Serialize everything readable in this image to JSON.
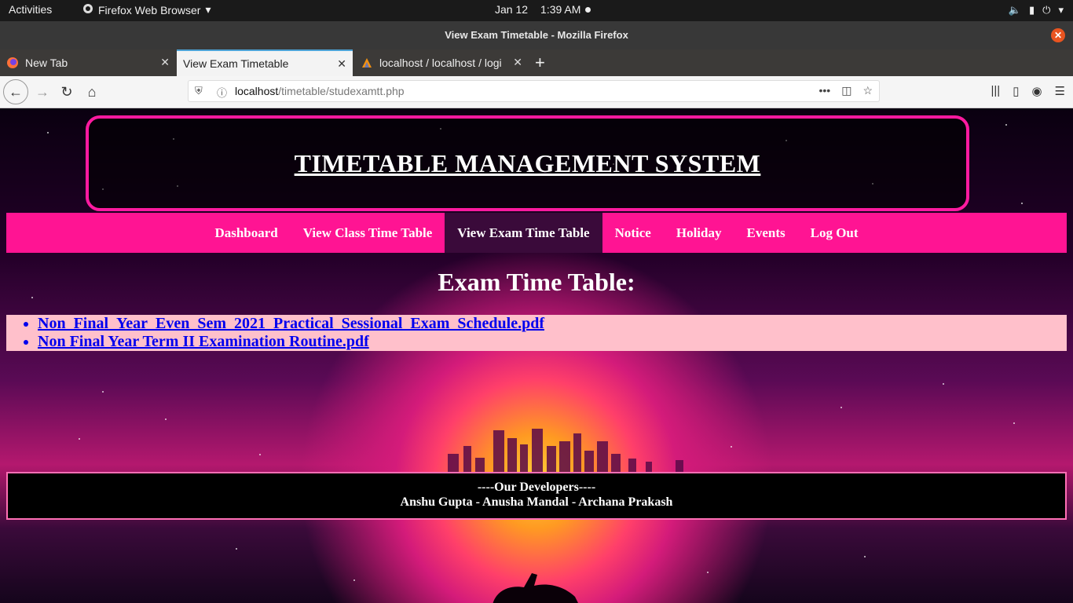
{
  "system": {
    "activities": "Activities",
    "app_name": "Firefox Web Browser",
    "date": "Jan 12",
    "time": "1:39 AM"
  },
  "window": {
    "title": "View Exam Timetable - Mozilla Firefox"
  },
  "tabs": [
    {
      "label": "New Tab"
    },
    {
      "label": "View Exam Timetable"
    },
    {
      "label": "localhost / localhost / logi"
    }
  ],
  "address": {
    "host": "localhost",
    "path": "/timetable/studexamtt.php"
  },
  "page": {
    "header_title": "TIMETABLE MANAGEMENT SYSTEM",
    "menu": [
      {
        "label": "Dashboard"
      },
      {
        "label": "View Class Time Table"
      },
      {
        "label": "View Exam Time Table"
      },
      {
        "label": "Notice"
      },
      {
        "label": "Holiday"
      },
      {
        "label": "Events"
      },
      {
        "label": "Log Out"
      }
    ],
    "section_title": "Exam Time Table:",
    "files": [
      {
        "name": "Non_Final_Year_Even_Sem_2021_Practical_Sessional_Exam_Schedule.pdf"
      },
      {
        "name": "Non Final Year Term II Examination Routine.pdf"
      }
    ],
    "footer": {
      "heading": "----Our Developers----",
      "names": "Anshu Gupta - Anusha Mandal - Archana Prakash"
    }
  },
  "colors": {
    "accent_pink": "#ff1493",
    "header_border": "#ff1aa0",
    "active_menu": "#3a0a3a",
    "file_list_bg": "#ffc0cb",
    "link": "#0000ee"
  },
  "icons": [
    "firefox-icon",
    "chevron-down-icon",
    "volume-icon",
    "battery-icon",
    "power-icon",
    "close-icon",
    "back-icon",
    "forward-icon",
    "reload-icon",
    "home-icon",
    "shield-icon",
    "info-icon",
    "more-icon",
    "pocket-icon",
    "star-icon",
    "library-icon",
    "sidebar-icon",
    "account-icon",
    "menu-icon",
    "plus-icon"
  ]
}
